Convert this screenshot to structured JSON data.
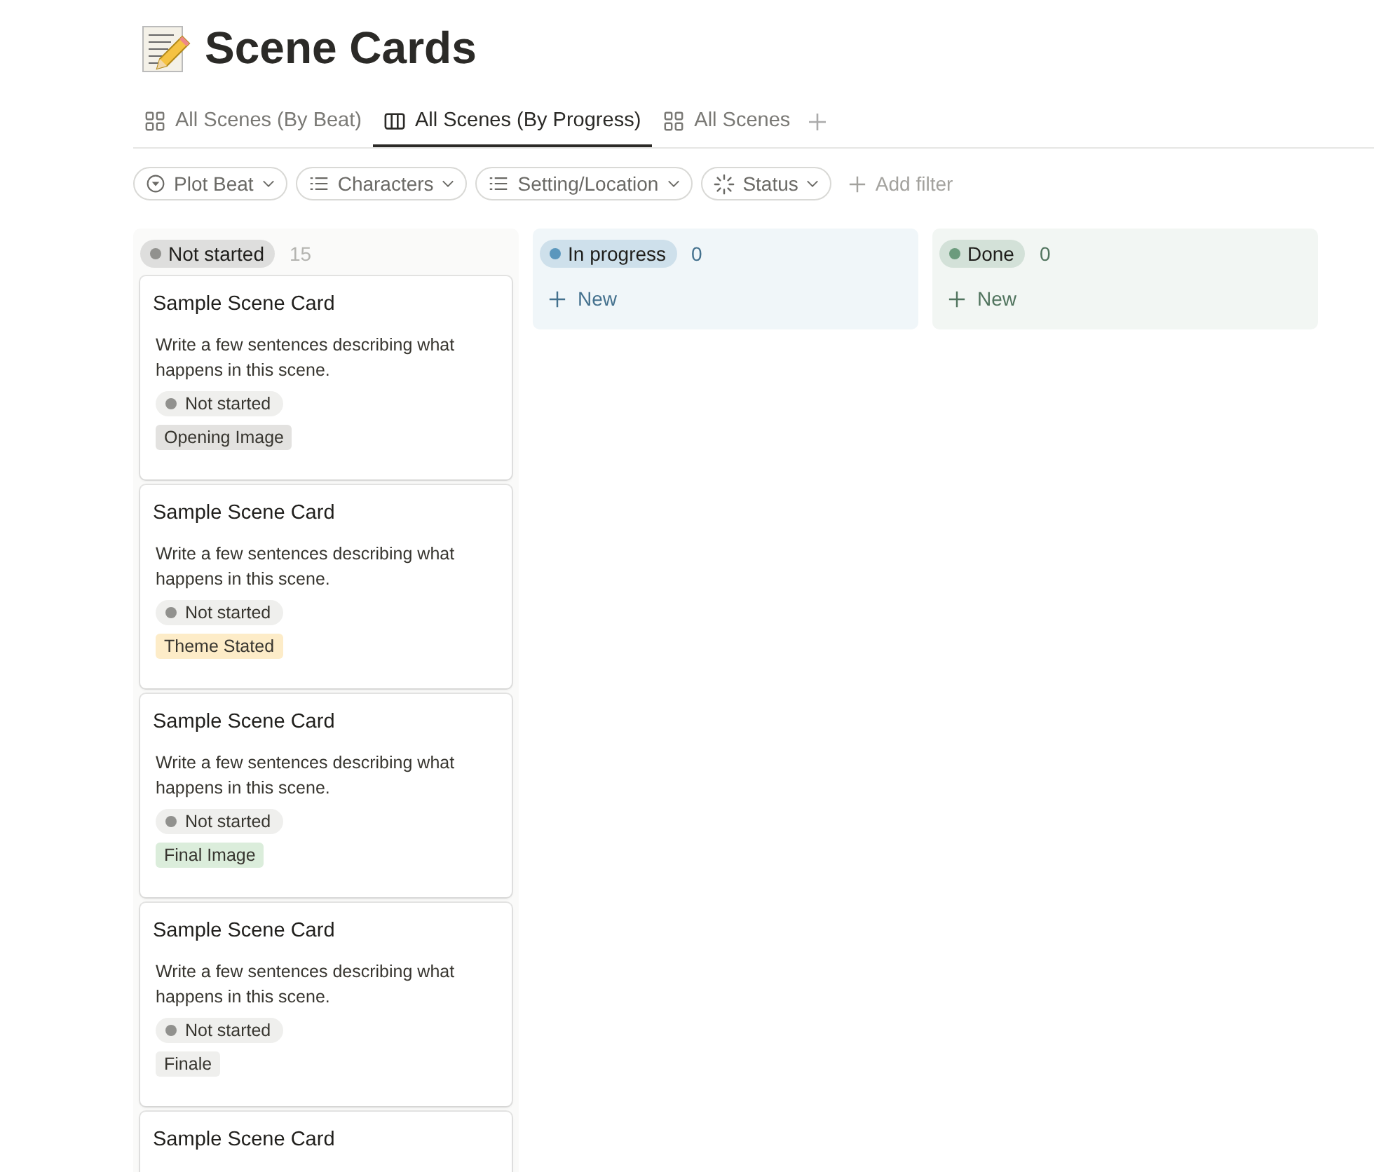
{
  "page": {
    "title": "Scene Cards"
  },
  "tabs": [
    {
      "label": "All Scenes (By Beat)",
      "kind": "gallery",
      "selected": false
    },
    {
      "label": "All Scenes (By Progress)",
      "kind": "board",
      "selected": true
    },
    {
      "label": "All Scenes",
      "kind": "gallery",
      "selected": false
    }
  ],
  "filters": [
    {
      "label": "Plot Beat",
      "kind": "select"
    },
    {
      "label": "Characters",
      "kind": "list"
    },
    {
      "label": "Setting/Location",
      "kind": "list"
    },
    {
      "label": "Status",
      "kind": "status"
    }
  ],
  "add_filter": "Add filter",
  "columns": [
    {
      "status": "Not started",
      "color": "#91918e",
      "count": "15",
      "cards": [
        {
          "title": "Sample Scene Card",
          "description": "Write a few sentences describing what happens in this scene.",
          "status": {
            "label": "Not started",
            "color": "#91918e"
          },
          "tag": {
            "label": "Opening Image",
            "color": "#e3e2e0"
          }
        },
        {
          "title": "Sample Scene Card",
          "description": "Write a few sentences describing what happens in this scene.",
          "status": {
            "label": "Not started",
            "color": "#91918e"
          },
          "tag": {
            "label": "Theme Stated",
            "color": "#fdecc8"
          }
        },
        {
          "title": "Sample Scene Card",
          "description": "Write a few sentences describing what happens in this scene.",
          "status": {
            "label": "Not started",
            "color": "#91918e"
          },
          "tag": {
            "label": "Final Image",
            "color": "#dbeddb"
          }
        },
        {
          "title": "Sample Scene Card",
          "description": "Write a few sentences describing what happens in this scene.",
          "status": {
            "label": "Not started",
            "color": "#91918e"
          },
          "tag": {
            "label": "Finale",
            "color": "#efefed"
          }
        },
        {
          "title": "Sample Scene Card"
        }
      ]
    },
    {
      "status": "In progress",
      "color": "#5b97bd",
      "count": "0",
      "new_label": "New"
    },
    {
      "status": "Done",
      "color": "#6c9b7d",
      "count": "0",
      "new_label": "New"
    }
  ]
}
